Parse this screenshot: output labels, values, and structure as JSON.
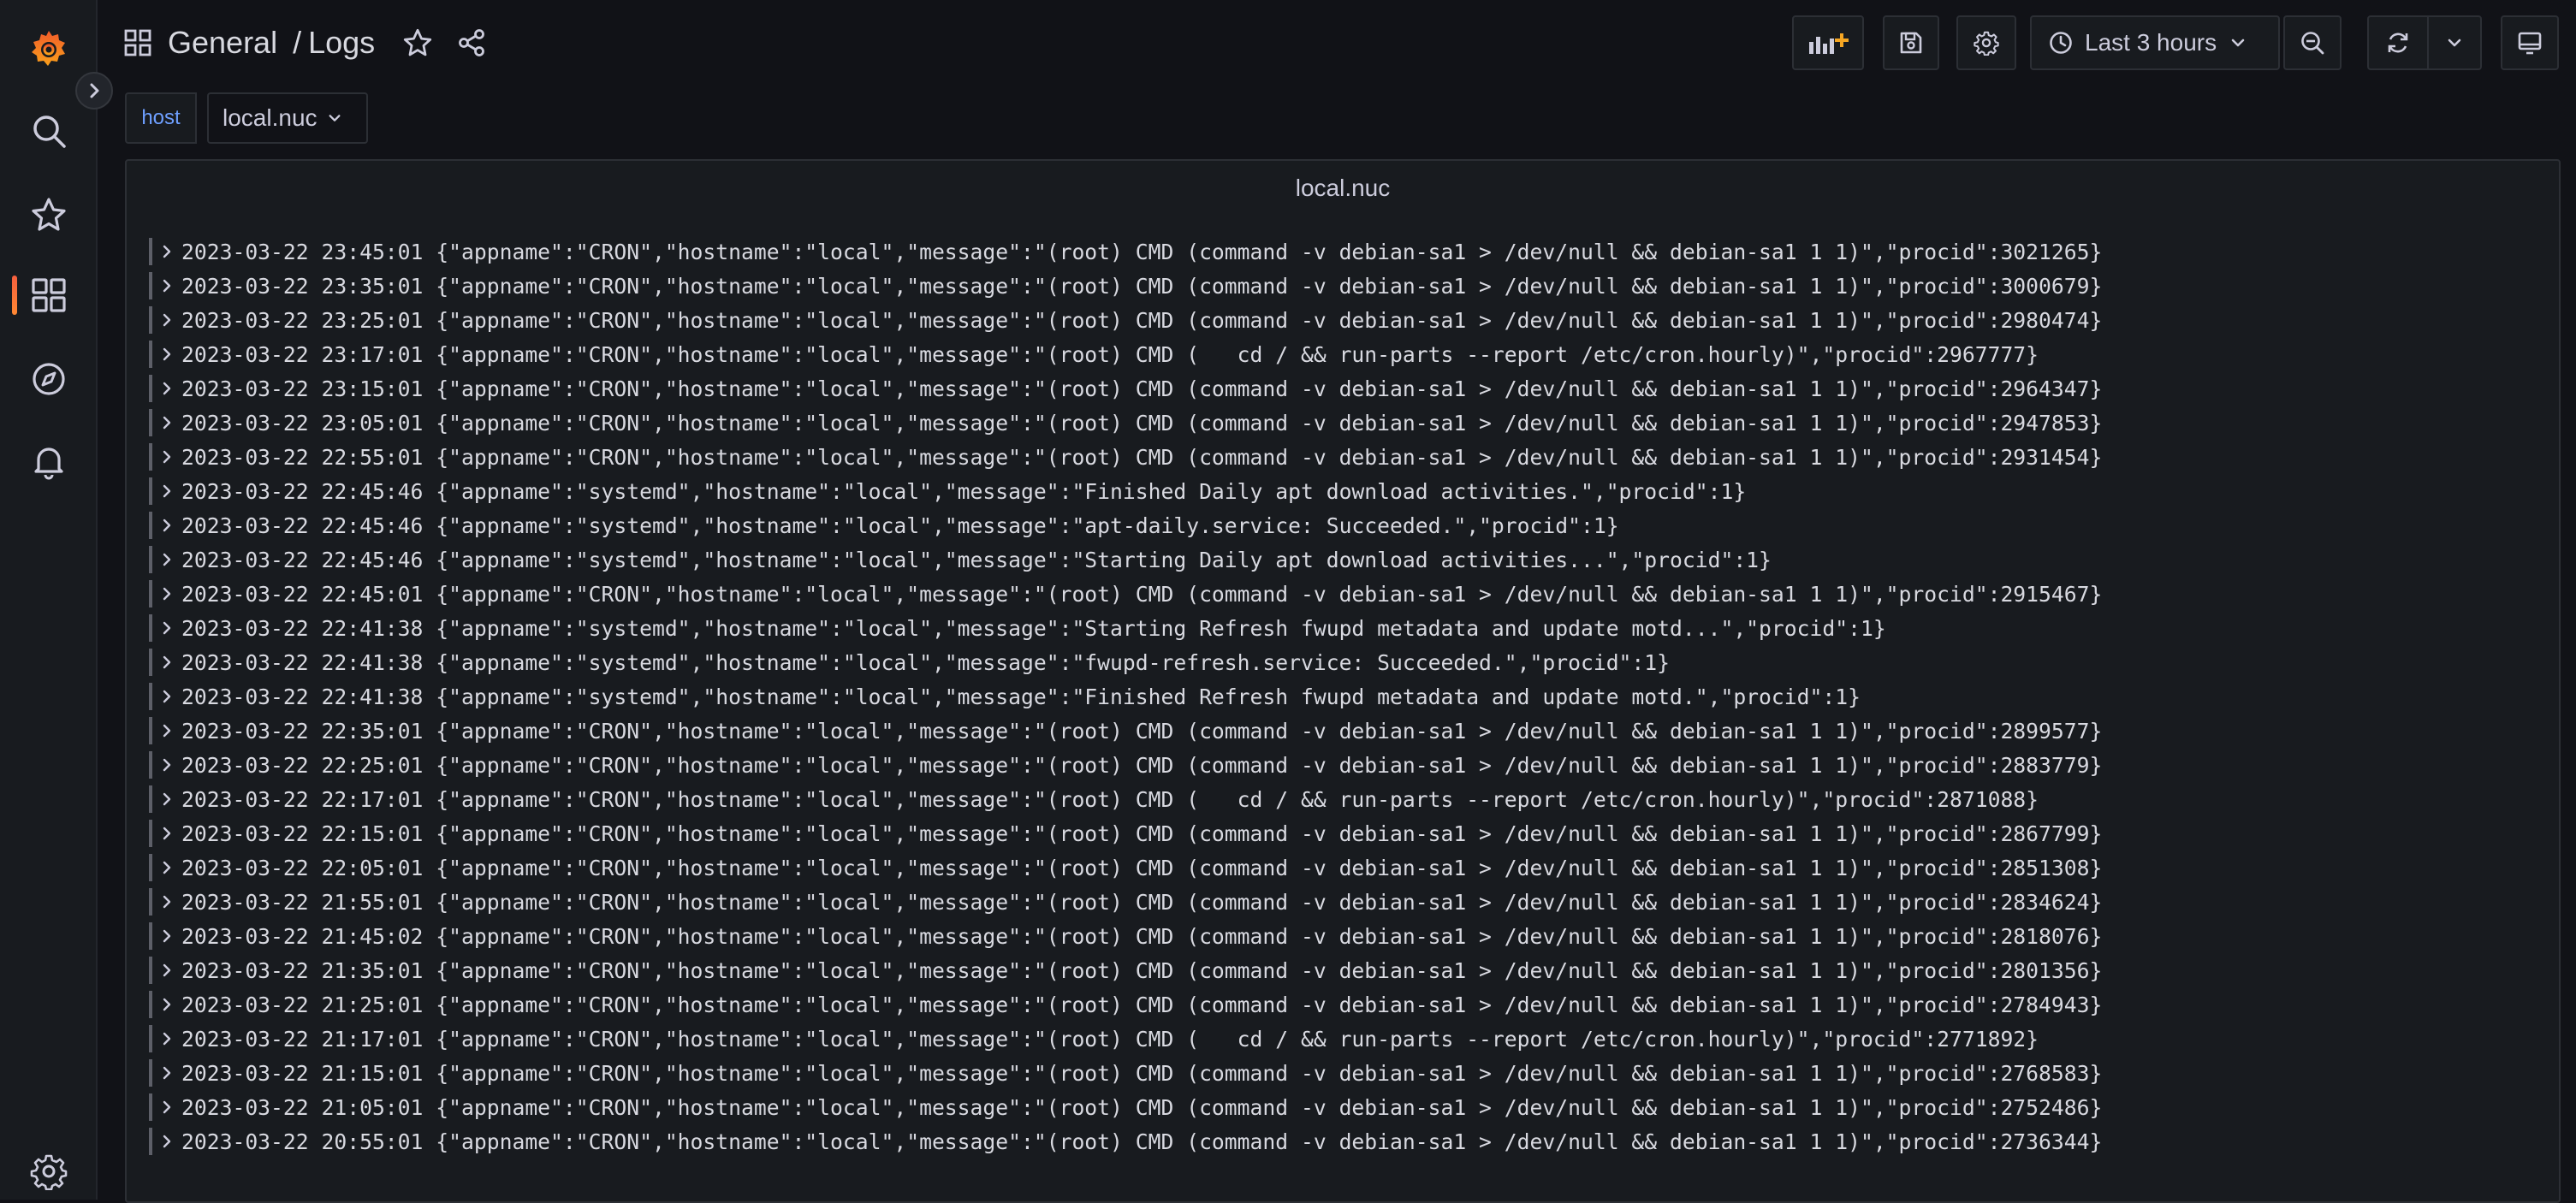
{
  "nav": {
    "logo_icon": "grafana-logo-icon",
    "items": [
      {
        "name": "search",
        "icon": "search-icon"
      },
      {
        "name": "starred",
        "icon": "star-icon"
      },
      {
        "name": "dashboards",
        "icon": "dashboards-icon",
        "active": true
      },
      {
        "name": "explore",
        "icon": "compass-icon"
      },
      {
        "name": "alerting",
        "icon": "bell-icon"
      },
      {
        "name": "configuration",
        "icon": "gear-icon"
      }
    ]
  },
  "breadcrumb": {
    "folder": "General",
    "separator": "/",
    "dashboard": "Logs"
  },
  "toolbar": {
    "time_range": "Last 3 hours"
  },
  "variables": [
    {
      "label": "host",
      "value": "local.nuc"
    }
  ],
  "panel": {
    "title": "local.nuc"
  },
  "logs": [
    {
      "time": "2023-03-22 23:45:01",
      "line": "{\"appname\":\"CRON\",\"hostname\":\"local\",\"message\":\"(root) CMD (command -v debian-sa1 > /dev/null && debian-sa1 1 1)\",\"procid\":3021265}"
    },
    {
      "time": "2023-03-22 23:35:01",
      "line": "{\"appname\":\"CRON\",\"hostname\":\"local\",\"message\":\"(root) CMD (command -v debian-sa1 > /dev/null && debian-sa1 1 1)\",\"procid\":3000679}"
    },
    {
      "time": "2023-03-22 23:25:01",
      "line": "{\"appname\":\"CRON\",\"hostname\":\"local\",\"message\":\"(root) CMD (command -v debian-sa1 > /dev/null && debian-sa1 1 1)\",\"procid\":2980474}"
    },
    {
      "time": "2023-03-22 23:17:01",
      "line": "{\"appname\":\"CRON\",\"hostname\":\"local\",\"message\":\"(root) CMD (   cd / && run-parts --report /etc/cron.hourly)\",\"procid\":2967777}"
    },
    {
      "time": "2023-03-22 23:15:01",
      "line": "{\"appname\":\"CRON\",\"hostname\":\"local\",\"message\":\"(root) CMD (command -v debian-sa1 > /dev/null && debian-sa1 1 1)\",\"procid\":2964347}"
    },
    {
      "time": "2023-03-22 23:05:01",
      "line": "{\"appname\":\"CRON\",\"hostname\":\"local\",\"message\":\"(root) CMD (command -v debian-sa1 > /dev/null && debian-sa1 1 1)\",\"procid\":2947853}"
    },
    {
      "time": "2023-03-22 22:55:01",
      "line": "{\"appname\":\"CRON\",\"hostname\":\"local\",\"message\":\"(root) CMD (command -v debian-sa1 > /dev/null && debian-sa1 1 1)\",\"procid\":2931454}"
    },
    {
      "time": "2023-03-22 22:45:46",
      "line": "{\"appname\":\"systemd\",\"hostname\":\"local\",\"message\":\"Finished Daily apt download activities.\",\"procid\":1}"
    },
    {
      "time": "2023-03-22 22:45:46",
      "line": "{\"appname\":\"systemd\",\"hostname\":\"local\",\"message\":\"apt-daily.service: Succeeded.\",\"procid\":1}"
    },
    {
      "time": "2023-03-22 22:45:46",
      "line": "{\"appname\":\"systemd\",\"hostname\":\"local\",\"message\":\"Starting Daily apt download activities...\",\"procid\":1}"
    },
    {
      "time": "2023-03-22 22:45:01",
      "line": "{\"appname\":\"CRON\",\"hostname\":\"local\",\"message\":\"(root) CMD (command -v debian-sa1 > /dev/null && debian-sa1 1 1)\",\"procid\":2915467}"
    },
    {
      "time": "2023-03-22 22:41:38",
      "line": "{\"appname\":\"systemd\",\"hostname\":\"local\",\"message\":\"Starting Refresh fwupd metadata and update motd...\",\"procid\":1}"
    },
    {
      "time": "2023-03-22 22:41:38",
      "line": "{\"appname\":\"systemd\",\"hostname\":\"local\",\"message\":\"fwupd-refresh.service: Succeeded.\",\"procid\":1}"
    },
    {
      "time": "2023-03-22 22:41:38",
      "line": "{\"appname\":\"systemd\",\"hostname\":\"local\",\"message\":\"Finished Refresh fwupd metadata and update motd.\",\"procid\":1}"
    },
    {
      "time": "2023-03-22 22:35:01",
      "line": "{\"appname\":\"CRON\",\"hostname\":\"local\",\"message\":\"(root) CMD (command -v debian-sa1 > /dev/null && debian-sa1 1 1)\",\"procid\":2899577}"
    },
    {
      "time": "2023-03-22 22:25:01",
      "line": "{\"appname\":\"CRON\",\"hostname\":\"local\",\"message\":\"(root) CMD (command -v debian-sa1 > /dev/null && debian-sa1 1 1)\",\"procid\":2883779}"
    },
    {
      "time": "2023-03-22 22:17:01",
      "line": "{\"appname\":\"CRON\",\"hostname\":\"local\",\"message\":\"(root) CMD (   cd / && run-parts --report /etc/cron.hourly)\",\"procid\":2871088}"
    },
    {
      "time": "2023-03-22 22:15:01",
      "line": "{\"appname\":\"CRON\",\"hostname\":\"local\",\"message\":\"(root) CMD (command -v debian-sa1 > /dev/null && debian-sa1 1 1)\",\"procid\":2867799}"
    },
    {
      "time": "2023-03-22 22:05:01",
      "line": "{\"appname\":\"CRON\",\"hostname\":\"local\",\"message\":\"(root) CMD (command -v debian-sa1 > /dev/null && debian-sa1 1 1)\",\"procid\":2851308}"
    },
    {
      "time": "2023-03-22 21:55:01",
      "line": "{\"appname\":\"CRON\",\"hostname\":\"local\",\"message\":\"(root) CMD (command -v debian-sa1 > /dev/null && debian-sa1 1 1)\",\"procid\":2834624}"
    },
    {
      "time": "2023-03-22 21:45:02",
      "line": "{\"appname\":\"CRON\",\"hostname\":\"local\",\"message\":\"(root) CMD (command -v debian-sa1 > /dev/null && debian-sa1 1 1)\",\"procid\":2818076}"
    },
    {
      "time": "2023-03-22 21:35:01",
      "line": "{\"appname\":\"CRON\",\"hostname\":\"local\",\"message\":\"(root) CMD (command -v debian-sa1 > /dev/null && debian-sa1 1 1)\",\"procid\":2801356}"
    },
    {
      "time": "2023-03-22 21:25:01",
      "line": "{\"appname\":\"CRON\",\"hostname\":\"local\",\"message\":\"(root) CMD (command -v debian-sa1 > /dev/null && debian-sa1 1 1)\",\"procid\":2784943}"
    },
    {
      "time": "2023-03-22 21:17:01",
      "line": "{\"appname\":\"CRON\",\"hostname\":\"local\",\"message\":\"(root) CMD (   cd / && run-parts --report /etc/cron.hourly)\",\"procid\":2771892}"
    },
    {
      "time": "2023-03-22 21:15:01",
      "line": "{\"appname\":\"CRON\",\"hostname\":\"local\",\"message\":\"(root) CMD (command -v debian-sa1 > /dev/null && debian-sa1 1 1)\",\"procid\":2768583}"
    },
    {
      "time": "2023-03-22 21:05:01",
      "line": "{\"appname\":\"CRON\",\"hostname\":\"local\",\"message\":\"(root) CMD (command -v debian-sa1 > /dev/null && debian-sa1 1 1)\",\"procid\":2752486}"
    },
    {
      "time": "2023-03-22 20:55:01",
      "line": "{\"appname\":\"CRON\",\"hostname\":\"local\",\"message\":\"(root) CMD (command -v debian-sa1 > /dev/null && debian-sa1 1 1)\",\"procid\":2736344}"
    }
  ]
}
